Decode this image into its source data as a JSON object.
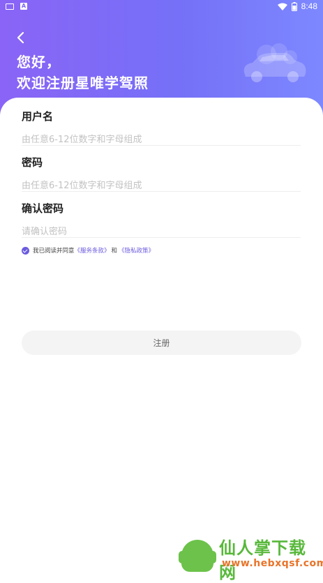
{
  "status_bar": {
    "time": "8:48",
    "app_indicator": "A"
  },
  "header": {
    "greeting_line1": "您好，",
    "greeting_line2": "欢迎注册星唯学驾照",
    "gradient_start": "#8a64f6",
    "gradient_end": "#7d88ff"
  },
  "form": {
    "username": {
      "label": "用户名",
      "placeholder": "由任意6-12位数字和字母组成"
    },
    "password": {
      "label": "密码",
      "placeholder": "由任意6-12位数字和字母组成"
    },
    "confirm_password": {
      "label": "确认密码",
      "placeholder": "请确认密码"
    }
  },
  "agreement": {
    "checked": true,
    "prefix": "我已阅读并同意",
    "terms_link": "《服务条款》",
    "conjunction": "和",
    "privacy_link": "《隐私政策》"
  },
  "register_button": {
    "label": "注册"
  },
  "watermark": {
    "title": "仙人掌下载网",
    "url": "www.hebxqsf.com"
  },
  "colors": {
    "accent": "#6b5bde",
    "button_bg": "#f4f4f4"
  }
}
